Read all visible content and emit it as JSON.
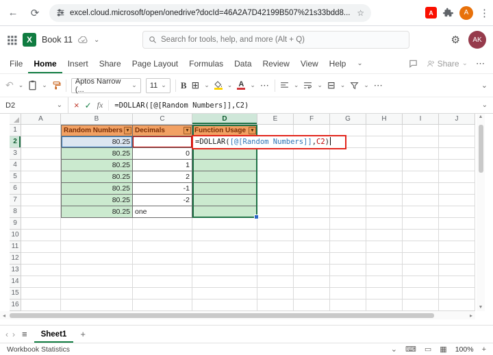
{
  "browser": {
    "url": "excel.cloud.microsoft/open/onedrive?docId=46A2A7D42199B507%21s33bdd8...",
    "avatar_initial": "A",
    "pdf_letter": "A"
  },
  "appbar": {
    "logo_letter": "X",
    "workbook_name": "Book 11",
    "search_placeholder": "Search for tools, help, and more (Alt + Q)",
    "avatar_initials": "AK"
  },
  "menubar": {
    "items": [
      "File",
      "Home",
      "Insert",
      "Share",
      "Page Layout",
      "Formulas",
      "Data",
      "Review",
      "View",
      "Help"
    ],
    "share_label": "Share"
  },
  "ribbon": {
    "font_name": "Aptos Narrow (...",
    "font_size": "11",
    "bold": "B",
    "font_color_letter": "A"
  },
  "formula_bar": {
    "name_box": "D2",
    "fx": "fx",
    "formula": "=DOLLAR([@[Random Numbers]],C2)"
  },
  "grid": {
    "columns": [
      "A",
      "B",
      "C",
      "D",
      "E",
      "F",
      "G",
      "H",
      "I",
      "J"
    ],
    "row_count": 16,
    "active_col": "D",
    "active_row": "2",
    "cells": [
      {
        "ref": "B1",
        "text": "Random Numbers",
        "type": "header"
      },
      {
        "ref": "C1",
        "text": "Decimals",
        "type": "header"
      },
      {
        "ref": "D1",
        "text": "Function Usage",
        "type": "header"
      },
      {
        "ref": "B2",
        "text": "80.25",
        "type": "ref-blue"
      },
      {
        "ref": "C2",
        "text": "",
        "type": "ref-red"
      },
      {
        "ref": "D2",
        "text": "",
        "type": "green"
      },
      {
        "ref": "B3",
        "text": "80.25",
        "type": "num-green"
      },
      {
        "ref": "C3",
        "text": "0",
        "type": "num-table"
      },
      {
        "ref": "D3",
        "text": "",
        "type": "green"
      },
      {
        "ref": "B4",
        "text": "80.25",
        "type": "num-green"
      },
      {
        "ref": "C4",
        "text": "1",
        "type": "num-table"
      },
      {
        "ref": "D4",
        "text": "",
        "type": "green"
      },
      {
        "ref": "B5",
        "text": "80.25",
        "type": "num-green"
      },
      {
        "ref": "C5",
        "text": "2",
        "type": "num-table"
      },
      {
        "ref": "D5",
        "text": "",
        "type": "green"
      },
      {
        "ref": "B6",
        "text": "80.25",
        "type": "num-green"
      },
      {
        "ref": "C6",
        "text": "-1",
        "type": "num-table"
      },
      {
        "ref": "D6",
        "text": "",
        "type": "green"
      },
      {
        "ref": "B7",
        "text": "80.25",
        "type": "num-green"
      },
      {
        "ref": "C7",
        "text": "-2",
        "type": "num-table"
      },
      {
        "ref": "D7",
        "text": "",
        "type": "green"
      },
      {
        "ref": "B8",
        "text": "80.25",
        "type": "num-green"
      },
      {
        "ref": "C8",
        "text": "one",
        "type": "text-table"
      },
      {
        "ref": "D8",
        "text": "",
        "type": "green"
      }
    ],
    "edit_cell": {
      "ref": "D2",
      "parts": [
        {
          "text": "=DOLLAR(",
          "color": "black"
        },
        {
          "text": "[@[Random Numbers]]",
          "color": "blue"
        },
        {
          "text": ",",
          "color": "black"
        },
        {
          "text": "C2",
          "color": "red"
        },
        {
          "text": ")",
          "color": "black"
        }
      ]
    }
  },
  "sheetbar": {
    "sheet_name": "Sheet1"
  },
  "statusbar": {
    "left_text": "Workbook Statistics",
    "zoom": "100%"
  },
  "colors": {
    "accent_green": "#107C41",
    "table_header_orange": "#F2A163",
    "table_cell_green": "#CBEACF",
    "ref_blue": "#2E75B6",
    "ref_red": "#C00000",
    "edit_border_red": "#E2231A"
  },
  "glyphs": {
    "back": "←",
    "refresh": "⟳",
    "menu_dots": "⋮",
    "caret_down": "⌄",
    "caret_small": "▾",
    "cloud": "☁",
    "gear": "⚙",
    "undo": "↶",
    "ellipsis": "⋯",
    "borders": "⊞",
    "merge": "⊟",
    "cancel": "×",
    "check": "✓",
    "plus": "+",
    "hamburger": "≡",
    "chev_left": "‹",
    "chev_right": "›",
    "tri_up": "▲",
    "tri_down": "▼",
    "tri_left": "◂",
    "tri_right": "▸",
    "keyboard": "⌨",
    "monitor": "▭",
    "book": "▦",
    "star": "☆"
  }
}
